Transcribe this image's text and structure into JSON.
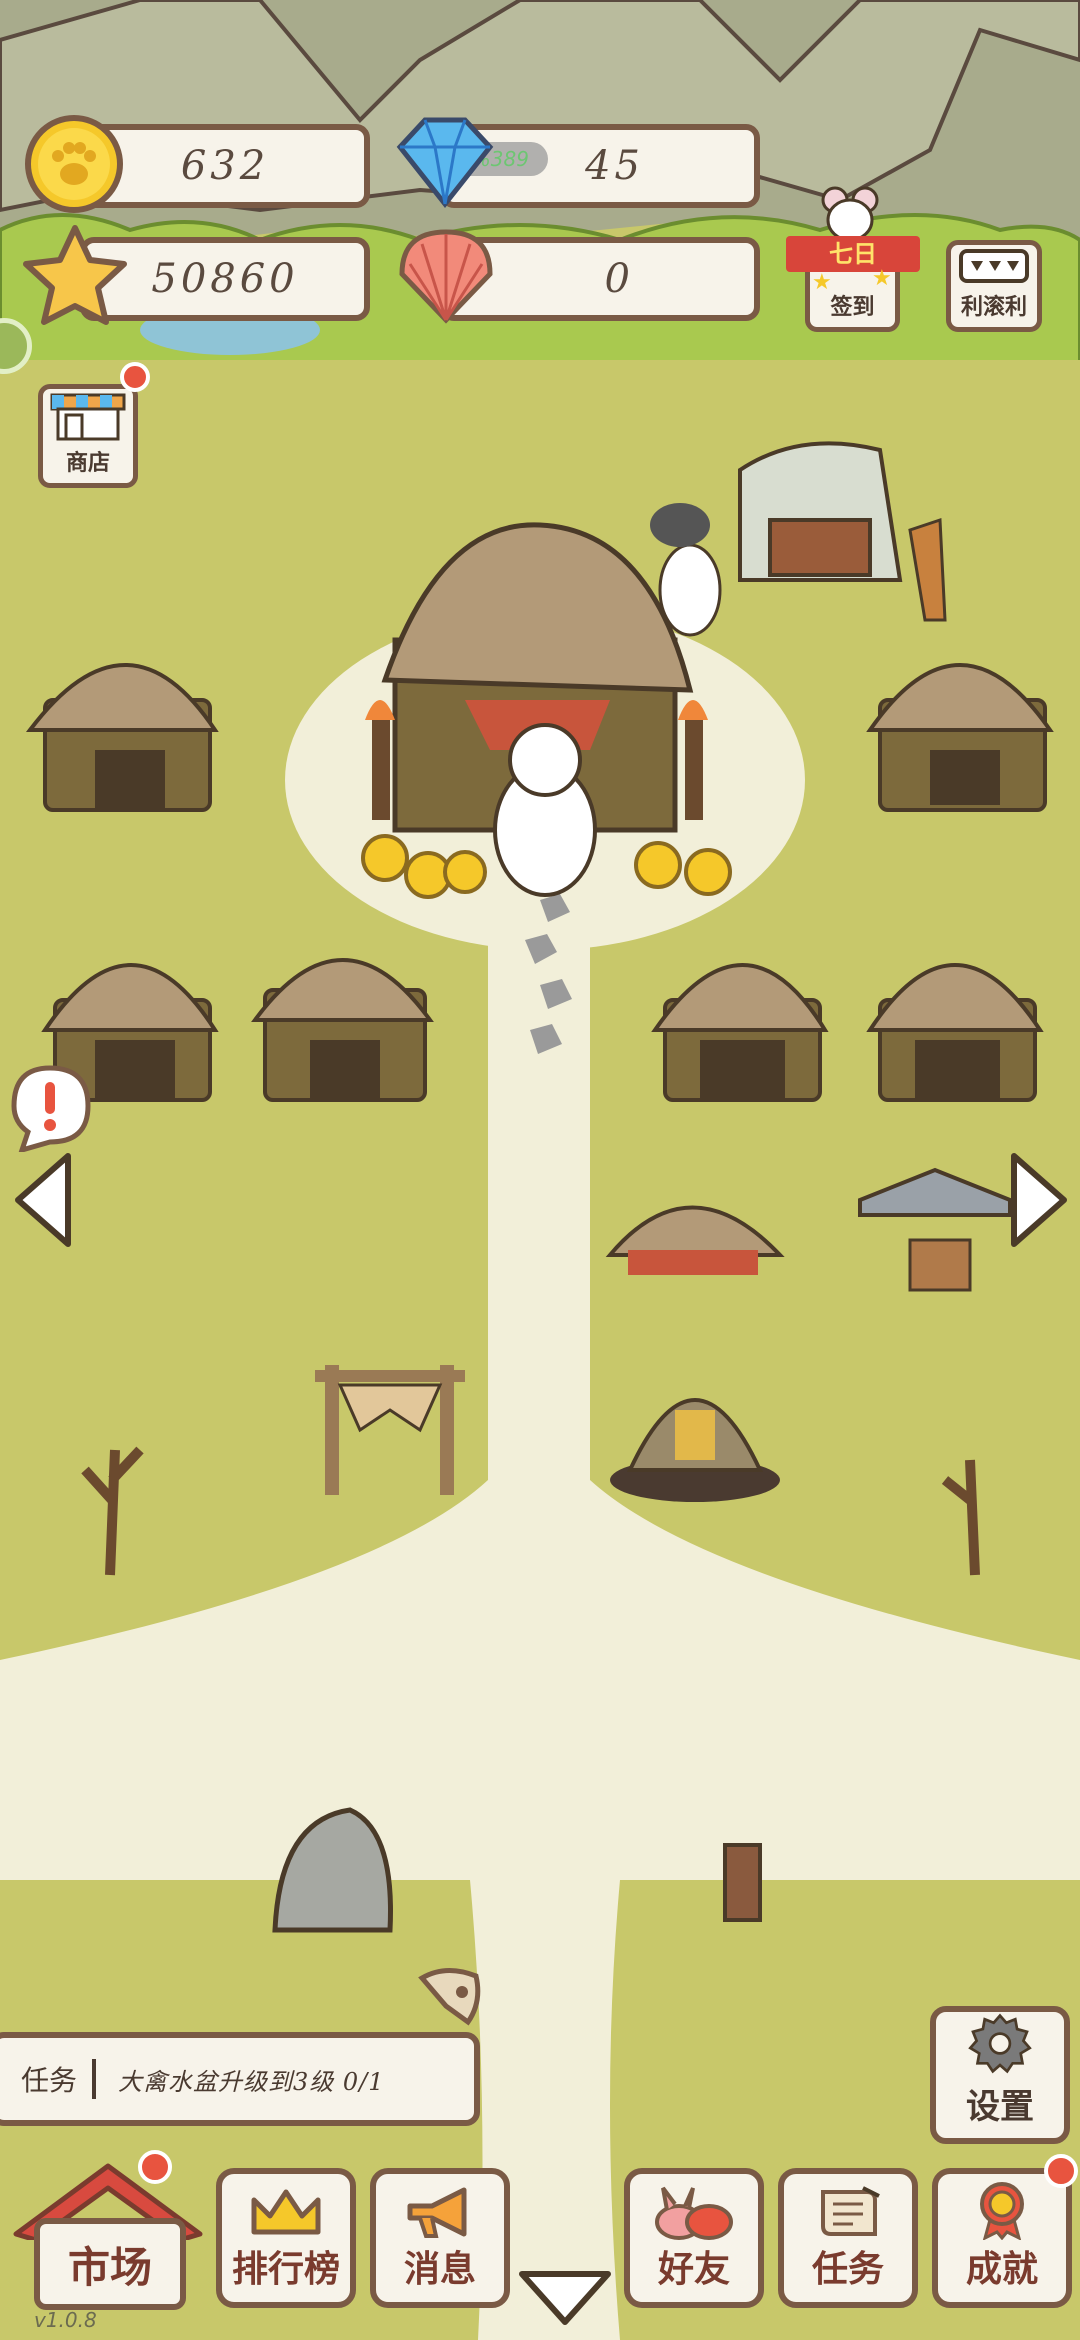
{
  "hud": {
    "coins": "632",
    "diamonds": "45",
    "diamond_overlay": "5%389",
    "stars": "50860",
    "shells": "0"
  },
  "top_buttons": {
    "signin_ribbon": "七日",
    "signin_label": "签到",
    "lottery_label": "利滚利"
  },
  "shop": {
    "label": "商店"
  },
  "task": {
    "title": "任务",
    "text": "大禽水盆升级到3级 0/1"
  },
  "settings": {
    "label": "设置"
  },
  "bottom_nav": {
    "market": "市场",
    "ranking": "排行榜",
    "messages": "消息",
    "friends": "好友",
    "tasks": "任务",
    "achievements": "成就"
  },
  "version": "v1.0.8",
  "colors": {
    "grass": "#c8c86a",
    "path": "#f2efd9",
    "outline": "#7a5a45",
    "badge": "#e8543f"
  }
}
